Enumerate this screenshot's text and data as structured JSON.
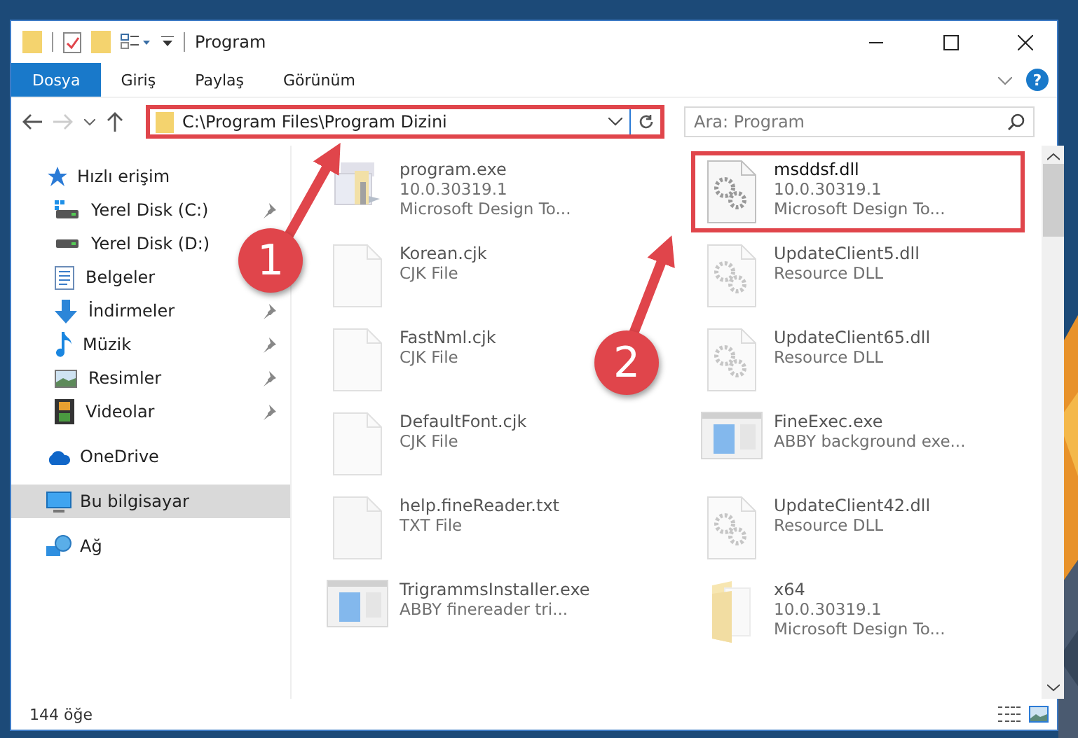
{
  "window": {
    "title": "Program"
  },
  "ribbon": {
    "tabs": [
      {
        "label": "Dosya",
        "kind": "file",
        "selected": false
      },
      {
        "label": "Giriş",
        "kind": "tab",
        "selected": false
      },
      {
        "label": "Paylaş",
        "kind": "tab",
        "selected": false
      },
      {
        "label": "Görünüm",
        "kind": "tab",
        "selected": false
      }
    ],
    "help": "?"
  },
  "address": {
    "path": "C:\\Program Files\\Program Dizini",
    "highlighted": true
  },
  "search": {
    "placeholder": "Ara: Program"
  },
  "sidebar": {
    "items": [
      {
        "label": "Hızlı erişim",
        "kind": "quick-access",
        "selected": false,
        "children": [
          {
            "label": "Yerel Disk (C:)",
            "kind": "system-drive",
            "pinned": true,
            "selected": false
          },
          {
            "label": "Yerel Disk (D:)",
            "kind": "drive",
            "pinned": false,
            "selected": false
          },
          {
            "label": "Belgeler",
            "kind": "documents",
            "pinned": false,
            "selected": false
          },
          {
            "label": "İndirmeler",
            "kind": "downloads",
            "pinned": true,
            "selected": false
          },
          {
            "label": "Müzik",
            "kind": "music",
            "pinned": true,
            "selected": false
          },
          {
            "label": "Resimler",
            "kind": "pictures",
            "pinned": true,
            "selected": false
          },
          {
            "label": "Videolar",
            "kind": "videos",
            "pinned": true,
            "selected": false
          }
        ]
      },
      {
        "label": "OneDrive",
        "kind": "cloud",
        "selected": false
      },
      {
        "label": "Bu bilgisayar",
        "kind": "computer",
        "selected": true
      },
      {
        "label": "Ağ",
        "kind": "network",
        "selected": false
      }
    ]
  },
  "files": [
    {
      "name": "program.exe",
      "details": [
        "10.0.30319.1",
        "Microsoft Design To..."
      ],
      "kind": "installer",
      "highlighted": false
    },
    {
      "name": "msddsf.dll",
      "details": [
        "10.0.30319.1",
        "Microsoft Design To..."
      ],
      "kind": "dll",
      "highlighted": true
    },
    {
      "name": "Korean.cjk",
      "details": [
        "CJK File"
      ],
      "kind": "blank",
      "highlighted": false
    },
    {
      "name": "UpdateClient5.dll",
      "details": [
        "Resource DLL"
      ],
      "kind": "dll",
      "highlighted": false
    },
    {
      "name": "FastNml.cjk",
      "details": [
        "CJK File"
      ],
      "kind": "blank",
      "highlighted": false
    },
    {
      "name": "UpdateClient65.dll",
      "details": [
        "Resource DLL"
      ],
      "kind": "dll",
      "highlighted": false
    },
    {
      "name": "DefaultFont.cjk",
      "details": [
        "CJK File"
      ],
      "kind": "blank",
      "highlighted": false
    },
    {
      "name": "FineExec.exe",
      "details": [
        "ABBY background exe..."
      ],
      "kind": "app",
      "highlighted": false
    },
    {
      "name": "help.fineReader.txt",
      "details": [
        "TXT File"
      ],
      "kind": "text",
      "highlighted": false
    },
    {
      "name": "UpdateClient42.dll",
      "details": [
        "Resource DLL"
      ],
      "kind": "dll",
      "highlighted": false
    },
    {
      "name": "TrigrammsInstaller.exe",
      "details": [
        "ABBY finereader tri..."
      ],
      "kind": "app",
      "highlighted": false
    },
    {
      "name": "x64",
      "details": [
        "10.0.30319.1",
        "Microsoft Design To..."
      ],
      "kind": "folder",
      "highlighted": false
    }
  ],
  "status_bar": {
    "count": "144 öğe"
  },
  "annotations": [
    {
      "label": "1"
    },
    {
      "label": "2"
    }
  ]
}
